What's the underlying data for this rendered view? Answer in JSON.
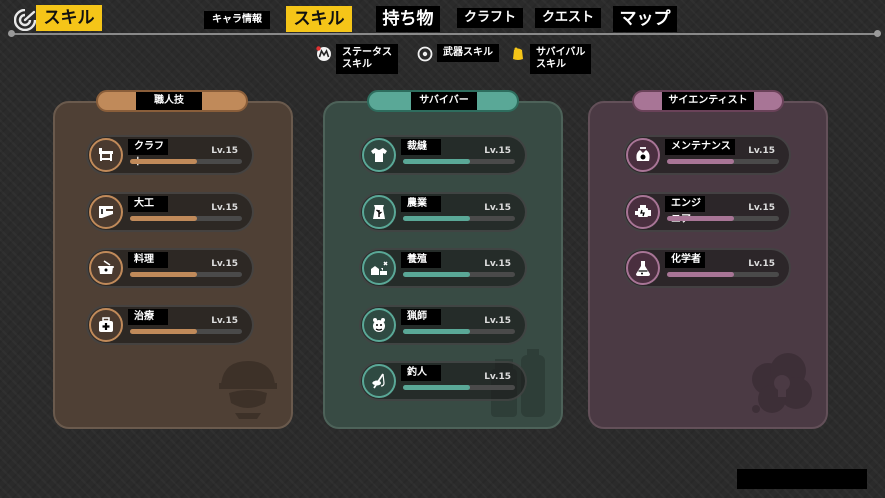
{
  "header": {
    "title": "スキル",
    "tabs": [
      {
        "label": "キャラ情報",
        "active": false
      },
      {
        "label": "スキル",
        "active": true
      },
      {
        "label": "持ち物",
        "active": false
      },
      {
        "label": "クラフト",
        "active": false
      },
      {
        "label": "クエスト",
        "active": false
      },
      {
        "label": "マップ",
        "active": false
      }
    ]
  },
  "subtabs": [
    {
      "label": "ステータス\nスキル",
      "icon": "status-skill-icon"
    },
    {
      "label": "武器スキル",
      "icon": "weapon-skill-icon"
    },
    {
      "label": "サバイバル\nスキル",
      "icon": "survival-skill-icon"
    }
  ],
  "colors": {
    "accent": "#f5c518",
    "artisan": "#c08a5a",
    "survivor": "#5aa897",
    "scientist": "#a87596"
  },
  "categories": [
    {
      "name": "職人技",
      "skills": [
        {
          "name": "クラフト",
          "level": "Lv.15",
          "progress": 0.6,
          "icon": "workbench-icon"
        },
        {
          "name": "大工",
          "level": "Lv.15",
          "progress": 0.6,
          "icon": "carpentry-icon"
        },
        {
          "name": "料理",
          "level": "Lv.15",
          "progress": 0.6,
          "icon": "cooking-pot-icon"
        },
        {
          "name": "治療",
          "level": "Lv.15",
          "progress": 0.6,
          "icon": "medical-kit-icon"
        }
      ]
    },
    {
      "name": "サバイバー",
      "skills": [
        {
          "name": "裁縫",
          "level": "Lv.15",
          "progress": 0.6,
          "icon": "shirt-icon"
        },
        {
          "name": "農業",
          "level": "Lv.15",
          "progress": 0.6,
          "icon": "seed-bag-icon"
        },
        {
          "name": "養殖",
          "level": "Lv.15",
          "progress": 0.6,
          "icon": "ranch-icon"
        },
        {
          "name": "猟師",
          "level": "Lv.15",
          "progress": 0.6,
          "icon": "trap-icon"
        },
        {
          "name": "釣人",
          "level": "Lv.15",
          "progress": 0.6,
          "icon": "fishing-icon"
        }
      ]
    },
    {
      "name": "サイエンティスト",
      "skills": [
        {
          "name": "メンテナンス",
          "level": "Lv.15",
          "progress": 0.6,
          "icon": "wrench-gear-icon"
        },
        {
          "name": "エンジニア",
          "level": "Lv.15",
          "progress": 0.6,
          "icon": "engine-icon"
        },
        {
          "name": "化学者",
          "level": "Lv.15",
          "progress": 0.6,
          "icon": "flask-icon"
        }
      ]
    }
  ]
}
